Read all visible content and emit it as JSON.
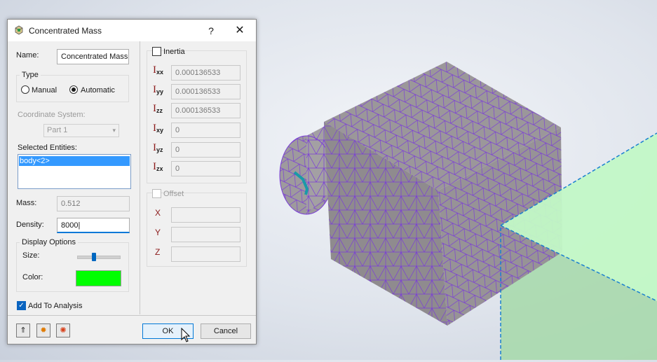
{
  "dialog": {
    "title": "Concentrated Mass",
    "help": "?",
    "close": "✕",
    "name_label": "Name:",
    "name_value": "Concentrated Mass",
    "type_group": "Type",
    "type_manual": "Manual",
    "type_automatic": "Automatic",
    "coord_label": "Coordinate System:",
    "coord_value": "Part 1",
    "selected_label": "Selected Entities:",
    "selected_items": [
      "body<2>"
    ],
    "mass_label": "Mass:",
    "mass_value": "0.512",
    "density_label": "Density:",
    "density_value": "8000",
    "display_group": "Display Options",
    "size_label": "Size:",
    "size_level": 0.4,
    "color_label": "Color:",
    "color_value": "#00ff00",
    "add_analysis": "Add To Analysis",
    "inertia_label": "Inertia",
    "inertia": {
      "xx": "0.000136533",
      "yy": "0.000136533",
      "zz": "0.000136533",
      "xy": "0",
      "yz": "0",
      "zx": "0"
    },
    "inertia_symbol": "I",
    "offset_label": "Offset",
    "offset_x": "X",
    "offset_y": "Y",
    "offset_z": "Z",
    "ok": "OK",
    "cancel": "Cancel"
  },
  "colors": {
    "accent": "#0078d7",
    "mesh_face": "#9a9598",
    "mesh_line": "#7a3cd8",
    "preview_box": "#b8f5c0"
  }
}
